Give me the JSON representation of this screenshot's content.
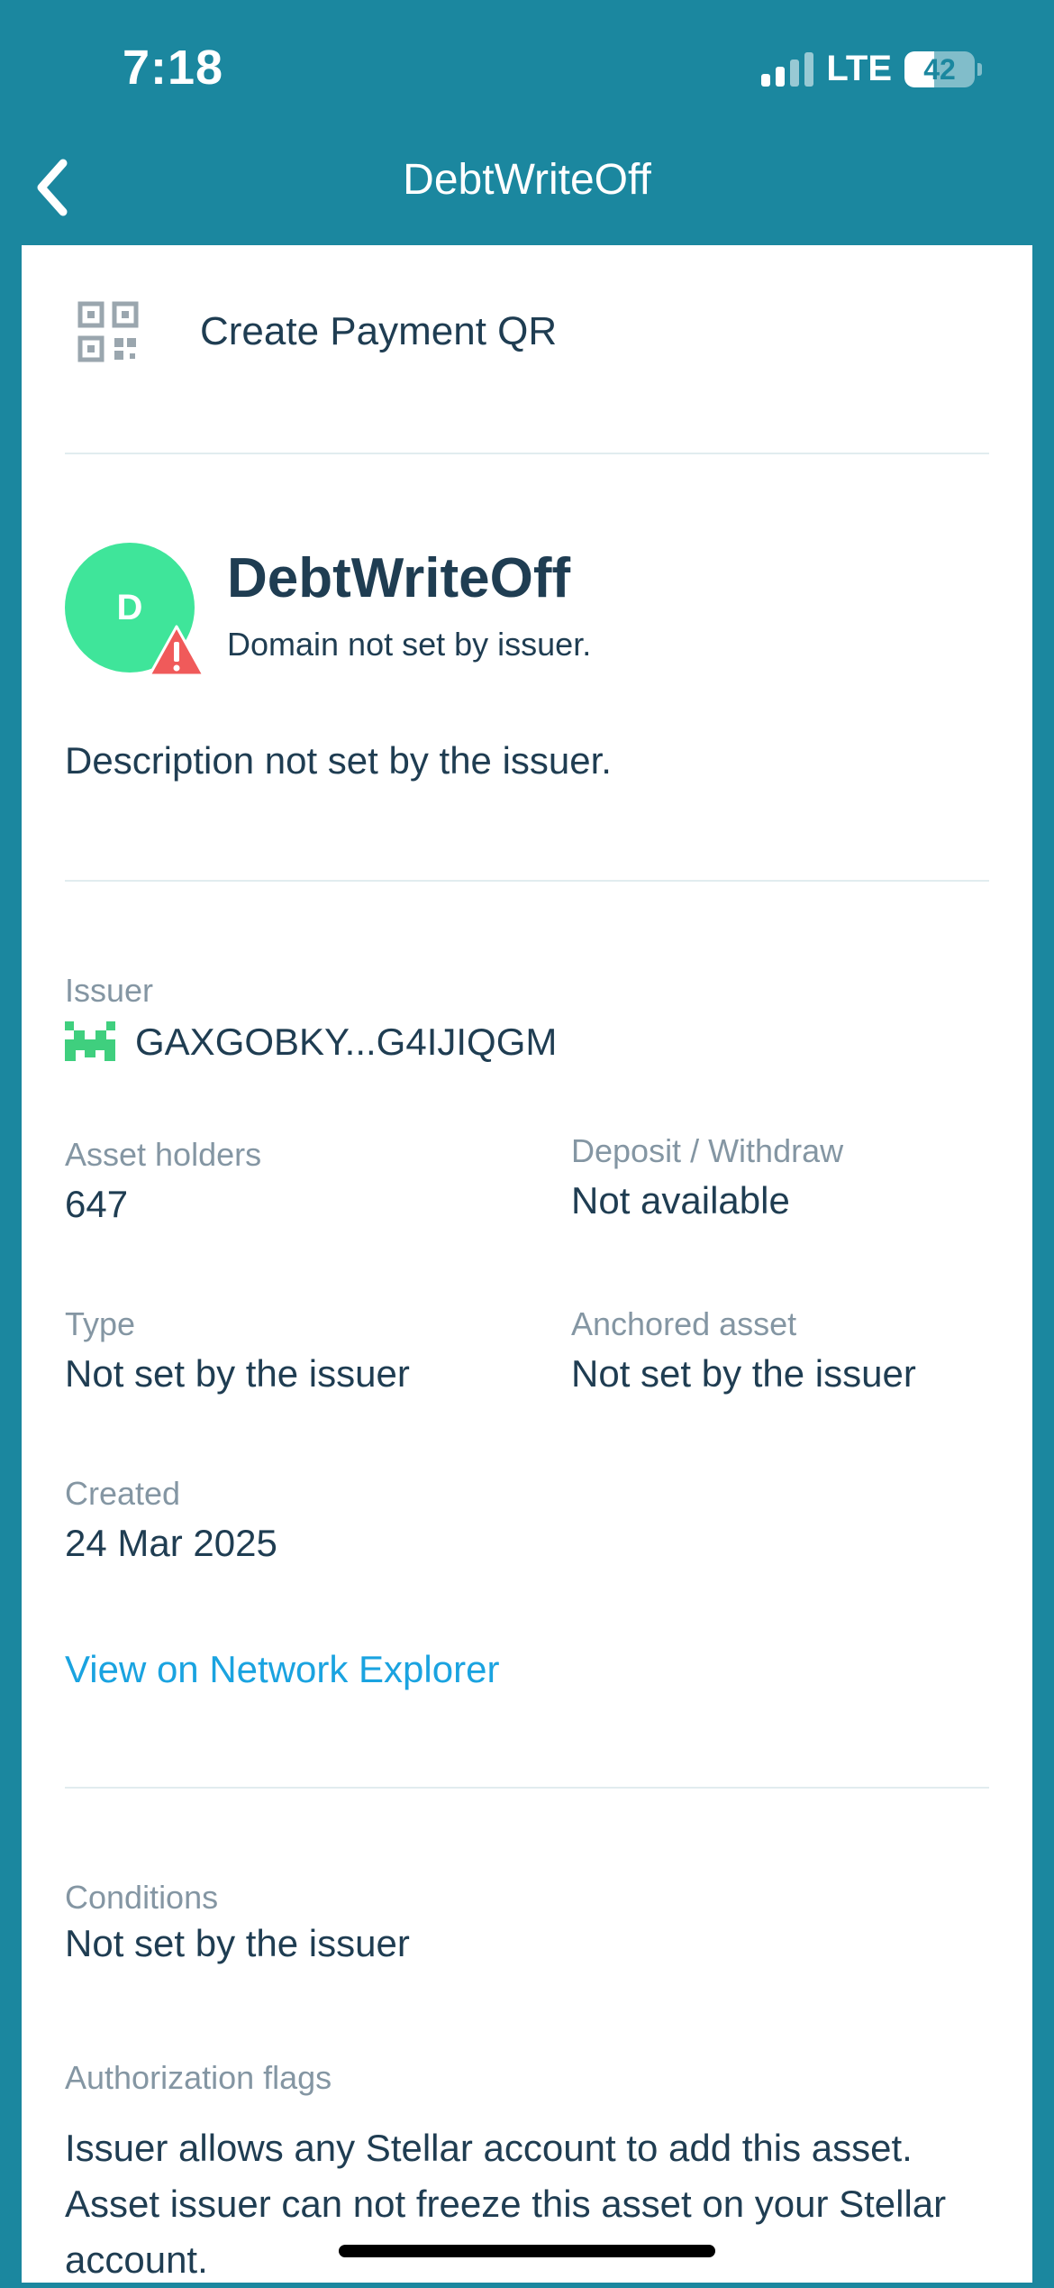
{
  "status_bar": {
    "time": "7:18",
    "network": "LTE",
    "battery": "42",
    "battery_level_percent": 42
  },
  "nav": {
    "title": "DebtWriteOff",
    "back_icon": "chevron-left-icon"
  },
  "qr_row": {
    "icon": "qr-code-icon",
    "label": "Create Payment QR"
  },
  "asset": {
    "avatar_letter": "D",
    "warning_icon": "warning-triangle-icon",
    "name": "DebtWriteOff",
    "domain": "Domain not set by issuer.",
    "description": "Description not set by the issuer."
  },
  "details": {
    "issuer_label": "Issuer",
    "issuer_icon": "identicon-icon",
    "issuer_value": "GAXGOBKY...G4IJIQGM",
    "holders_label": "Asset holders",
    "holders_value": "647",
    "deposit_label": "Deposit / Withdraw",
    "deposit_value": "Not available",
    "type_label": "Type",
    "type_value": "Not set by the issuer",
    "anchored_label": "Anchored asset",
    "anchored_value": "Not set by the issuer",
    "created_label": "Created",
    "created_value": "24 Mar 2025",
    "explorer_link": "View on Network Explorer"
  },
  "conditions": {
    "conditions_label": "Conditions",
    "conditions_value": "Not set by the issuer",
    "auth_label": "Authorization flags",
    "auth_line1": "Issuer allows any Stellar account to add this asset.",
    "auth_line2": "Asset issuer can not freeze this asset on your Stellar account."
  },
  "colors": {
    "header": "#1b879f",
    "accent_link": "#1aa3e0",
    "avatar": "#3fe59a",
    "warning": "#f05a5a",
    "text": "#1f3d52",
    "muted": "#8496a3"
  }
}
